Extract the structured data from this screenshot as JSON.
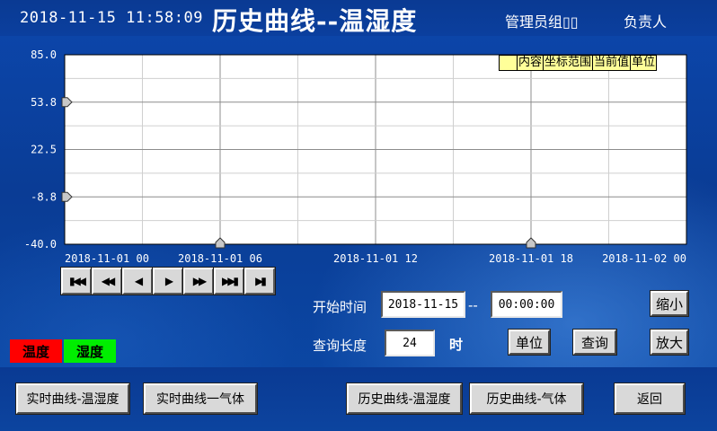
{
  "header": {
    "datetime": "2018-11-15 11:58:09",
    "title": "历史曲线--温湿度",
    "role": "管理员组▯▯",
    "person": "负责人"
  },
  "legend": {
    "columns": [
      "内容",
      "坐标范围",
      "当前值",
      "单位"
    ]
  },
  "chart_data": {
    "type": "line",
    "series": [],
    "ylim": [
      -40.0,
      85.0
    ],
    "y_ticks": [
      "85.0",
      "53.8",
      "22.5",
      "-8.8",
      "-40.0"
    ],
    "x_ticks": [
      "2018-11-01 00",
      "2018-11-01 06",
      "2018-11-01 12",
      "2018-11-01 18",
      "2018-11-02 00"
    ],
    "grid": true,
    "legend_position": "top-right",
    "colors": {
      "plot_bg": "#ffffff",
      "grid": "#b0b0b0",
      "frame": "#000000"
    }
  },
  "nav": {
    "buttons": [
      {
        "glyph": "▮◀◀",
        "icon": "first-page-icon"
      },
      {
        "glyph": "◀◀",
        "icon": "fast-backward-icon"
      },
      {
        "glyph": "◀",
        "icon": "step-backward-icon"
      },
      {
        "glyph": "▶",
        "icon": "step-forward-icon"
      },
      {
        "glyph": "▶▶",
        "icon": "fast-forward-icon"
      },
      {
        "glyph": "▶▶▮",
        "icon": "last-page-icon"
      },
      {
        "glyph": "▶▮",
        "icon": "end-icon"
      }
    ]
  },
  "query": {
    "start_label": "开始时间",
    "start_date": "2018-11-15",
    "separator": "--",
    "start_time": "00:00:00",
    "length_label": "查询长度",
    "length_value": "24",
    "length_unit": "时",
    "unit_button": "单位",
    "query_button": "查询",
    "zoom_out_button": "缩小",
    "zoom_in_button": "放大"
  },
  "tags": {
    "temperature": "温度",
    "humidity": "湿度",
    "temperature_color": "#ff0000",
    "humidity_color": "#00ee00"
  },
  "footer": {
    "realtime_th": "实时曲线-温湿度",
    "realtime_gas": "实时曲线一气体",
    "history_th": "历史曲线-温湿度",
    "history_gas": "历史曲线-气体",
    "back": "返回"
  }
}
